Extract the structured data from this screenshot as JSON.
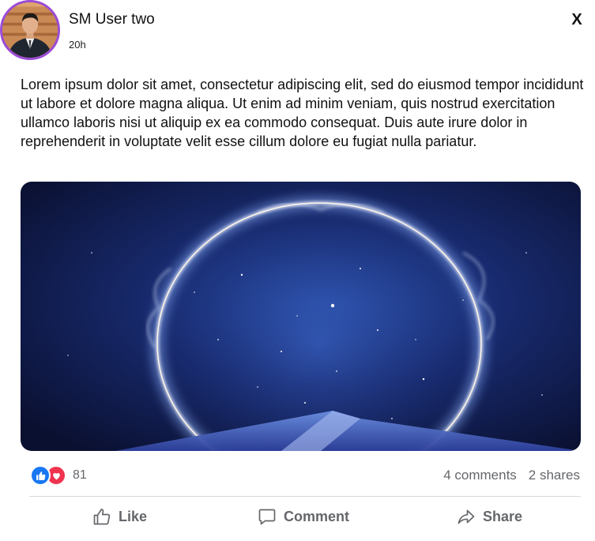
{
  "post": {
    "author": "SM User two",
    "timestamp": "20h",
    "close_label": "X",
    "text": "Lorem ipsum dolor sit amet, consectetur adipiscing elit, sed do eiusmod tempor incididunt ut labore et dolore magna aliqua. Ut enim ad minim veniam, quis nostrud exercitation ullamco laboris nisi ut aliquip ex ea commodo consequat. Duis aute irure dolor in reprehenderit in voluptate velit esse cillum dolore eu fugiat nulla pariatur."
  },
  "stats": {
    "reaction_count": "81",
    "comments": "4 comments",
    "shares": "2 shares",
    "reaction_icons": [
      "like-icon",
      "love-icon"
    ]
  },
  "actions": {
    "like_label": "Like",
    "comment_label": "Comment",
    "share_label": "Share"
  },
  "colors": {
    "avatar_ring": "#9b4bd6",
    "like_blue": "#1877f2",
    "love_red": "#f0334f",
    "muted_text": "#65676b"
  }
}
